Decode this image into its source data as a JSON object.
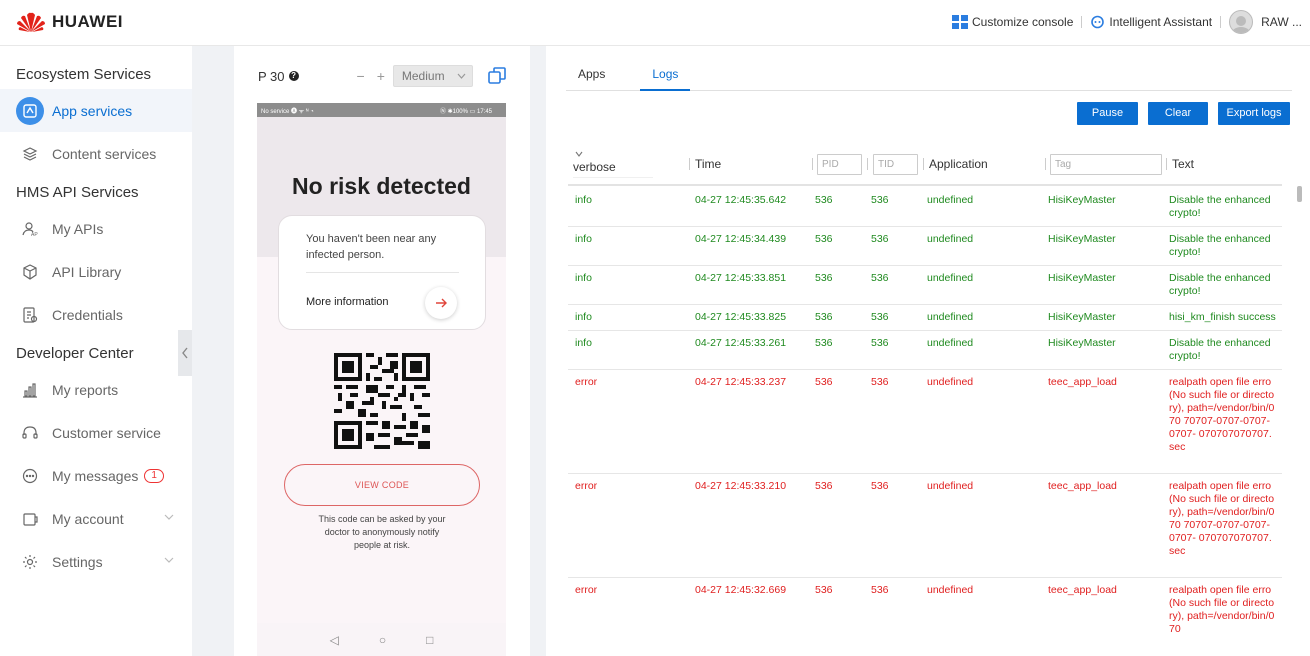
{
  "brand": {
    "name": "HUAWEI"
  },
  "topbar": {
    "customize": "Customize console",
    "assistant": "Intelligent Assistant",
    "user": "RAW ..."
  },
  "sidebar": {
    "sections": [
      {
        "title": "Ecosystem Services",
        "items": [
          {
            "label": "App services",
            "icon": "app-icon",
            "active": true
          },
          {
            "label": "Content services",
            "icon": "layers-icon"
          }
        ]
      },
      {
        "title": "HMS API Services",
        "items": [
          {
            "label": "My APIs",
            "icon": "api-user-icon"
          },
          {
            "label": "API Library",
            "icon": "cube-icon"
          },
          {
            "label": "Credentials",
            "icon": "credential-icon"
          }
        ]
      },
      {
        "title": "Developer Center",
        "items": [
          {
            "label": "My reports",
            "icon": "bar-chart-icon"
          },
          {
            "label": "Customer service",
            "icon": "headset-icon"
          },
          {
            "label": "My messages",
            "icon": "message-icon",
            "badge": "1"
          },
          {
            "label": "My account",
            "icon": "account-icon",
            "expandable": true
          },
          {
            "label": "Settings",
            "icon": "gear-icon",
            "expandable": true
          }
        ]
      }
    ]
  },
  "device": {
    "model": "P 30",
    "zoom_minus": "−",
    "zoom_plus": "+",
    "size": "Medium",
    "statusbar_left": "No service 🅐 ᯤ ᴺ ◔",
    "statusbar_right": "Ⓝ ✱100% ▭ 17:45",
    "screen": {
      "title": "No risk detected",
      "card_text": "You haven't been near any infected person.",
      "more_info": "More information",
      "view_code": "VIEW CODE",
      "note": "This code can be asked by your doctor to anonymously notify people at risk."
    },
    "nav": {
      "back": "◁",
      "home": "○",
      "recent": "□"
    }
  },
  "logs": {
    "tabs": [
      {
        "label": "Apps"
      },
      {
        "label": "Logs",
        "active": true
      }
    ],
    "buttons": {
      "pause": "Pause",
      "clear": "Clear",
      "export": "Export logs"
    },
    "header": {
      "level": "verbose",
      "time": "Time",
      "pid_placeholder": "PID",
      "tid_placeholder": "TID",
      "application": "Application",
      "tag_placeholder": "Tag",
      "text": "Text"
    },
    "rows": [
      {
        "level": "info",
        "time": "04-27 12:45:35.642",
        "pid": "536",
        "tid": "536",
        "app": "undefined",
        "tag": "HisiKeyMaster",
        "text": "Disable the enhanced crypto!"
      },
      {
        "level": "info",
        "time": "04-27 12:45:34.439",
        "pid": "536",
        "tid": "536",
        "app": "undefined",
        "tag": "HisiKeyMaster",
        "text": "Disable the enhanced crypto!"
      },
      {
        "level": "info",
        "time": "04-27 12:45:33.851",
        "pid": "536",
        "tid": "536",
        "app": "undefined",
        "tag": "HisiKeyMaster",
        "text": "Disable the enhanced crypto!"
      },
      {
        "level": "info",
        "time": "04-27 12:45:33.825",
        "pid": "536",
        "tid": "536",
        "app": "undefined",
        "tag": "HisiKeyMaster",
        "text": "hisi_km_finish success"
      },
      {
        "level": "info",
        "time": "04-27 12:45:33.261",
        "pid": "536",
        "tid": "536",
        "app": "undefined",
        "tag": "HisiKeyMaster",
        "text": "Disable the enhanced crypto!"
      },
      {
        "level": "error",
        "time": "04-27 12:45:33.237",
        "pid": "536",
        "tid": "536",
        "app": "undefined",
        "tag": "teec_app_load",
        "text": "realpath open file erro(No such file or directory), path=/vendor/bin/070 70707-0707-0707-0707- 070707070707.sec"
      },
      {
        "level": "error",
        "time": "04-27 12:45:33.210",
        "pid": "536",
        "tid": "536",
        "app": "undefined",
        "tag": "teec_app_load",
        "text": "realpath open file erro(No such file or directory), path=/vendor/bin/070 70707-0707-0707-0707- 070707070707.sec"
      },
      {
        "level": "error",
        "time": "04-27 12:45:32.669",
        "pid": "536",
        "tid": "536",
        "app": "undefined",
        "tag": "teec_app_load",
        "text": "realpath open file erro(No such file or directory), path=/vendor/bin/070"
      }
    ]
  }
}
